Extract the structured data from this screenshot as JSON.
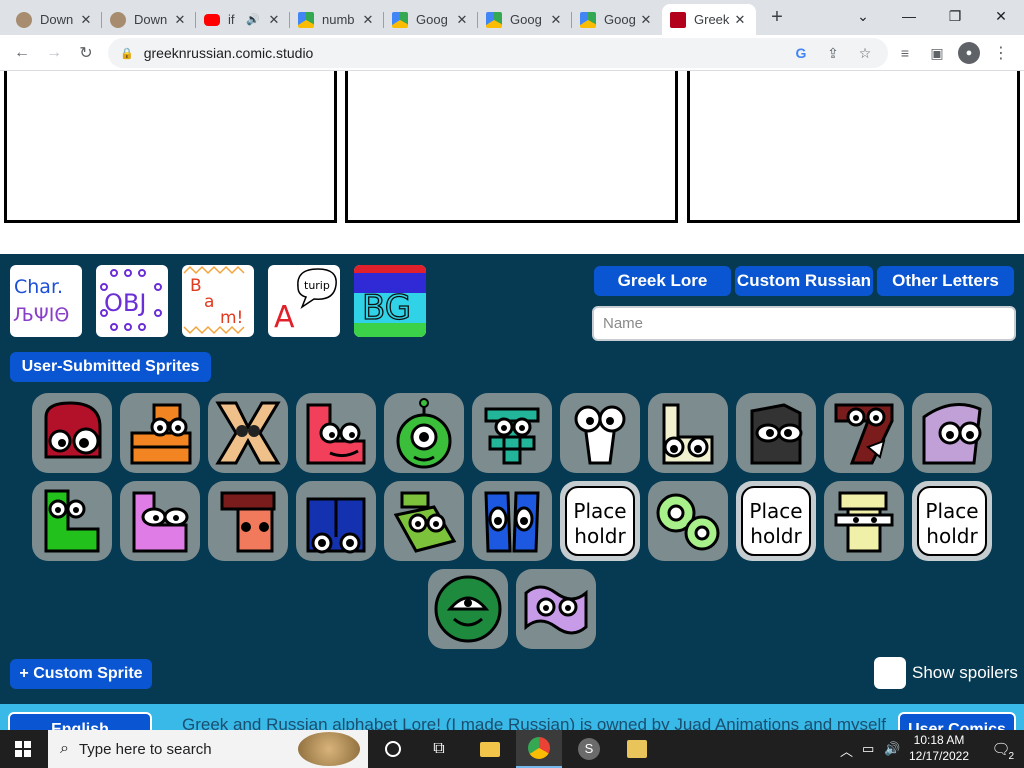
{
  "browser": {
    "tabs": [
      {
        "label": "Down",
        "favicon": "photo-favicon"
      },
      {
        "label": "Down",
        "favicon": "photo-favicon"
      },
      {
        "label": "if",
        "favicon": "youtube-favicon",
        "audio": "speaker-icon"
      },
      {
        "label": "numb",
        "favicon": "drive-favicon"
      },
      {
        "label": "Goog",
        "favicon": "drive-favicon"
      },
      {
        "label": "Goog",
        "favicon": "drive-favicon"
      },
      {
        "label": "Goog",
        "favicon": "drive-favicon"
      },
      {
        "label": "Greek",
        "favicon": "comic-studio-favicon",
        "active": true
      }
    ],
    "url": "greeknrussian.comic.studio"
  },
  "maker": {
    "categories": [
      {
        "name": "characters",
        "text": "Char. ЉΨΙΘ"
      },
      {
        "name": "objects",
        "text": "OBJ"
      },
      {
        "name": "bam",
        "text": "Bam!"
      },
      {
        "name": "speech",
        "text": "turip A"
      },
      {
        "name": "backgrounds",
        "text": "BG"
      }
    ],
    "lore_buttons": [
      "Greek Lore",
      "Custom Russian",
      "Other Letters"
    ],
    "name_placeholder": "Name",
    "user_sprites_label": "User-Submitted Sprites",
    "placeholder_top": "Place",
    "placeholder_bottom": "holdr",
    "custom_sprite_button": "+ Custom Sprite",
    "show_spoilers": "Show spoilers",
    "footer_left_button": "English",
    "footer_text": "Greek and Russian alphabet Lore! (I made Russian) is owned by Juad Animations and myself",
    "footer_right_button": "User Comics"
  },
  "taskbar": {
    "search_placeholder": "Type here to search",
    "time": "10:18 AM",
    "date": "12/17/2022",
    "notification_count": "2"
  },
  "colors": {
    "maker_bg": "#063a52",
    "accent_button": "#0a55d1",
    "footer_bar": "#38b9e8"
  }
}
